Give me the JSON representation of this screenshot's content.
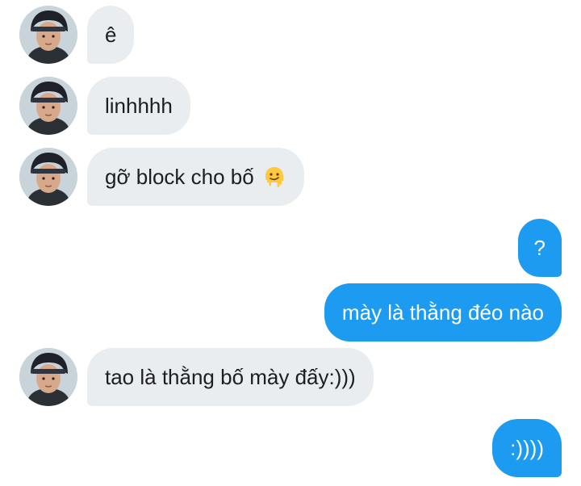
{
  "conversation": {
    "messages": [
      {
        "sender": "other",
        "text": "ê"
      },
      {
        "sender": "other",
        "text": "linhhhh"
      },
      {
        "sender": "other",
        "text": "gỡ block cho bố",
        "emoji": "melting-face"
      },
      {
        "sender": "me",
        "text": "?"
      },
      {
        "sender": "me",
        "text": "mày là thằng đéo nào"
      },
      {
        "sender": "other",
        "text": "tao là thằng bố mày đấy:)))"
      },
      {
        "sender": "me",
        "text": ":))))"
      }
    ]
  },
  "colors": {
    "incoming_bubble": "#e9edf0",
    "outgoing_bubble": "#1d9bf0",
    "incoming_text": "#1c1e21",
    "outgoing_text": "#ffffff"
  },
  "icons": {
    "avatar": "profile-photo-helmet",
    "emoji": "melting-face-emoji"
  }
}
